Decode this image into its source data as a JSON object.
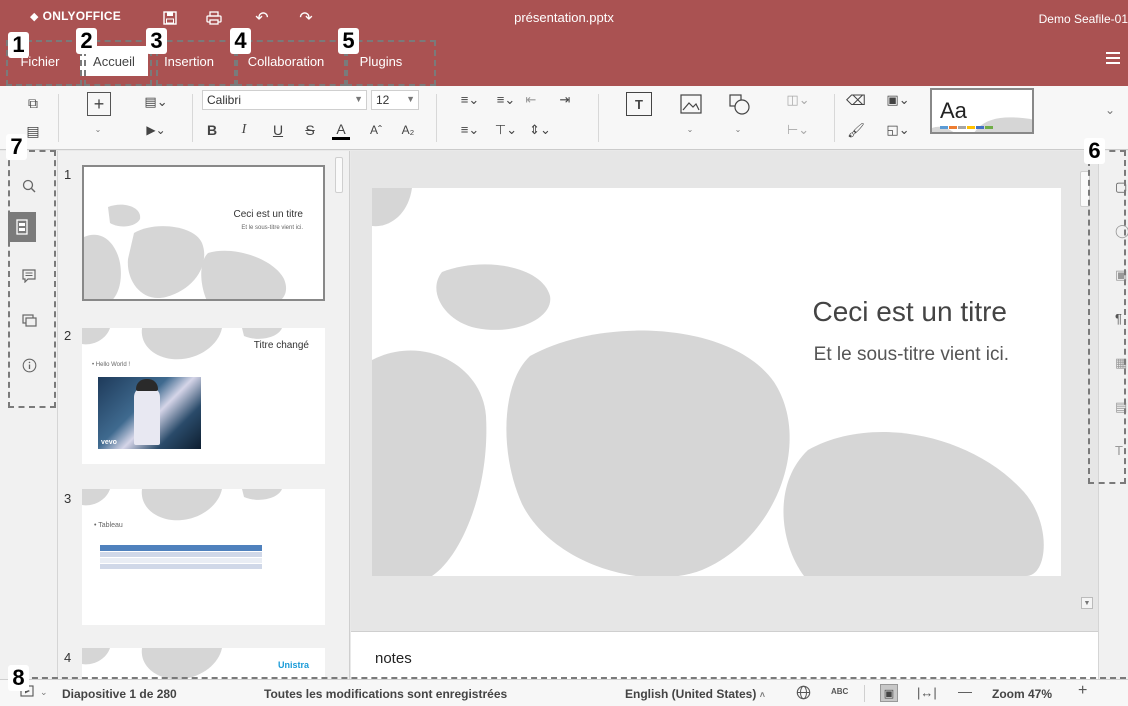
{
  "app": {
    "logo_text": "ONLYOFFICE",
    "document_title": "présentation.pptx",
    "user": "Demo Seafile-01"
  },
  "colors": {
    "accent": "#aa5252",
    "toolbar_bg": "#f7f7f7",
    "panel_bg": "#f1f1f1",
    "shape_gray": "#d6d6d6",
    "link_blue": "#1a9bd8",
    "comment_orange": "#e06a2c"
  },
  "quick_access": [
    {
      "icon": "save-icon"
    },
    {
      "icon": "print-icon"
    },
    {
      "icon": "undo-icon"
    },
    {
      "icon": "redo-icon"
    }
  ],
  "tabs": [
    {
      "label": "Fichier",
      "active": false
    },
    {
      "label": "Accueil",
      "active": true
    },
    {
      "label": "Insertion",
      "active": false
    },
    {
      "label": "Collaboration",
      "active": false
    },
    {
      "label": "Plugins",
      "active": false
    }
  ],
  "toolbar": {
    "font_name": "Calibri",
    "font_size": "12",
    "bold_label": "B",
    "italic_label": "I",
    "underline_label": "U",
    "strike_label": "S",
    "font_color_label": "A",
    "increase_font_label": "Aˆ",
    "subscript_label": "A₂",
    "theme_label": "Aa"
  },
  "thumbnails": [
    {
      "num": "1",
      "title": "Ceci est un titre",
      "subtitle": "Et le sous-titre vient ici."
    },
    {
      "num": "2",
      "title": "Titre changé",
      "bullet": "Hello World !",
      "video_brand": "vevo"
    },
    {
      "num": "3",
      "bullet": "Tableau"
    },
    {
      "num": "4",
      "title": "Unistra"
    }
  ],
  "slide": {
    "title": "Ceci est un titre",
    "subtitle": "Et le sous-titre vient ici."
  },
  "notes_label": "notes",
  "status": {
    "slide_position": "Diapositive 1 de 280",
    "save_state": "Toutes les modifications sont enregistrées",
    "language": "English (United States)",
    "zoom": "Zoom 47%"
  },
  "markers": [
    "1",
    "2",
    "3",
    "4",
    "5",
    "6",
    "7",
    "8"
  ]
}
